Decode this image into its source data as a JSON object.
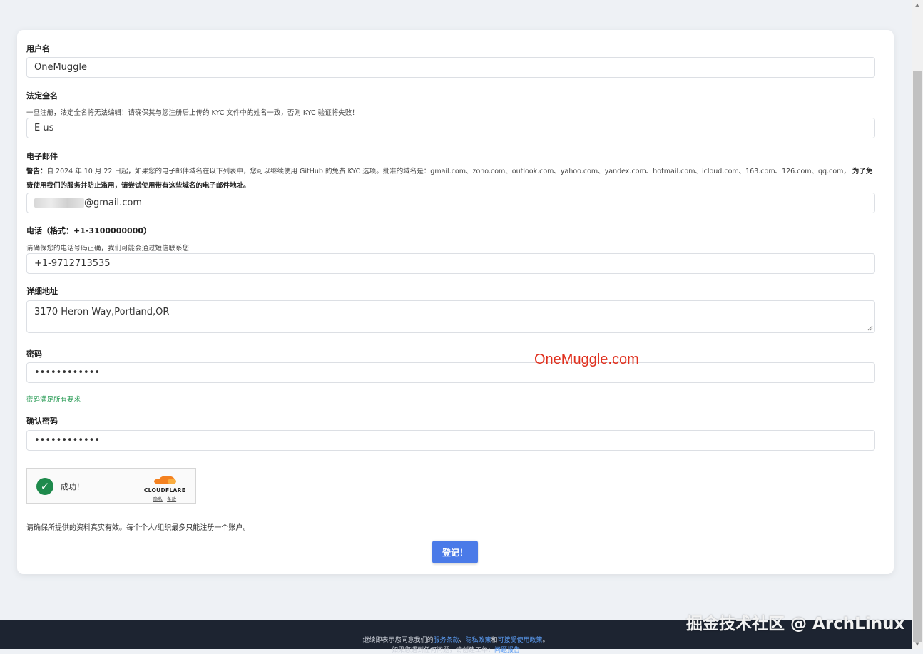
{
  "form": {
    "username": {
      "label": "用户名",
      "value": "OneMuggle"
    },
    "fullname": {
      "label": "法定全名",
      "help": "一旦注册，法定全名将无法编辑！请确保其与您注册后上传的 KYC 文件中的姓名一致，否则 KYC 验证将失败！",
      "value": "E us"
    },
    "email": {
      "label": "电子邮件",
      "warning_prefix": "警告：",
      "warning_text": "自 2024 年 10 月 22 日起，如果您的电子邮件域名在以下列表中，您可以继续使用 GitHub 的免费 KYC 选项。批准的域名是：gmail.com、zoho.com、outlook.com、yahoo.com、yandex.com、hotmail.com、icloud.com、163.com、126.com、qq.com，",
      "warning_bold": "为了免费使用我们的服务并防止滥用，请尝试使用带有这些域名的电子邮件地址。",
      "value_suffix": "@gmail.com"
    },
    "phone": {
      "label": "电话（格式：+1-3100000000）",
      "help": "请确保您的电话号码正确，我们可能会通过短信联系您",
      "value": "+1-9712713535"
    },
    "address": {
      "label": "详细地址",
      "value": "3170  Heron Way,Portland,OR"
    },
    "password": {
      "label": "密码",
      "value": "••••••••••••",
      "status": "密码满足所有要求"
    },
    "confirm": {
      "label": "确认密码",
      "value": "••••••••••••"
    },
    "captcha": {
      "status": "成功！",
      "brand": "CLOUDFLARE",
      "link_privacy": "隐私",
      "link_sep": " · ",
      "link_terms": "条款"
    },
    "note": "请确保所提供的资料真实有效。每个个人/组织最多只能注册一个账户。",
    "submit_label": "登记！"
  },
  "watermark": "OneMuggle.com",
  "footer": {
    "line1_prefix": "继续即表示您同意我们的",
    "terms": "服务条款",
    "sep1": "、",
    "privacy": "隐私政策",
    "and": "和",
    "aup": "可接受使用政策",
    "end": "。",
    "line2_prefix": "如果您遇到任何问题，请创建工单：",
    "line2_link": "问题报告"
  },
  "corner_watermark": "掘金技术社区 @ ArchLinux",
  "colors": {
    "accent": "#4a7ae8",
    "success": "#2f9e5a",
    "footer_bg": "#1d2431",
    "link": "#5b9cf3"
  }
}
